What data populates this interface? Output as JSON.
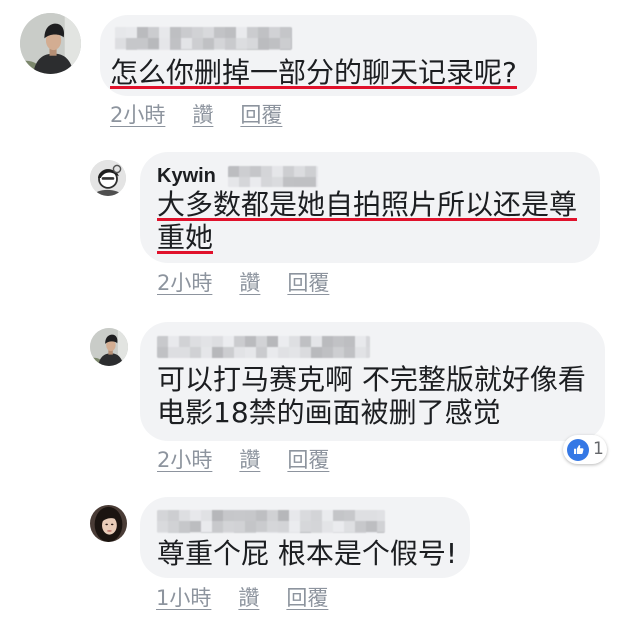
{
  "theme": {
    "background": "#ffffff",
    "bubble": "#f2f3f5",
    "text": "#1c1e21",
    "meta": "#8d949e",
    "underline": "#e0112b",
    "like": "#3578e5"
  },
  "comments": [
    {
      "lines": [
        "怎么你删掉一部分的聊天记录呢?"
      ],
      "time": "2小時",
      "like_label": "讚",
      "reply_label": "回覆"
    },
    {
      "author": "Kywin",
      "lines": [
        "大多数都是她自拍照片所以还是尊",
        "重她"
      ],
      "time": "2小時",
      "like_label": "讚",
      "reply_label": "回覆"
    },
    {
      "lines": [
        "可以打马赛克啊 不完整版就好像看",
        "电影18禁的画面被删了感觉"
      ],
      "time": "2小時",
      "like_label": "讚",
      "reply_label": "回覆",
      "reaction": {
        "icon": "like-icon",
        "count": "1"
      }
    },
    {
      "lines": [
        "尊重个屁 根本是个假号!"
      ],
      "time": "1小時",
      "like_label": "讚",
      "reply_label": "回覆"
    }
  ]
}
